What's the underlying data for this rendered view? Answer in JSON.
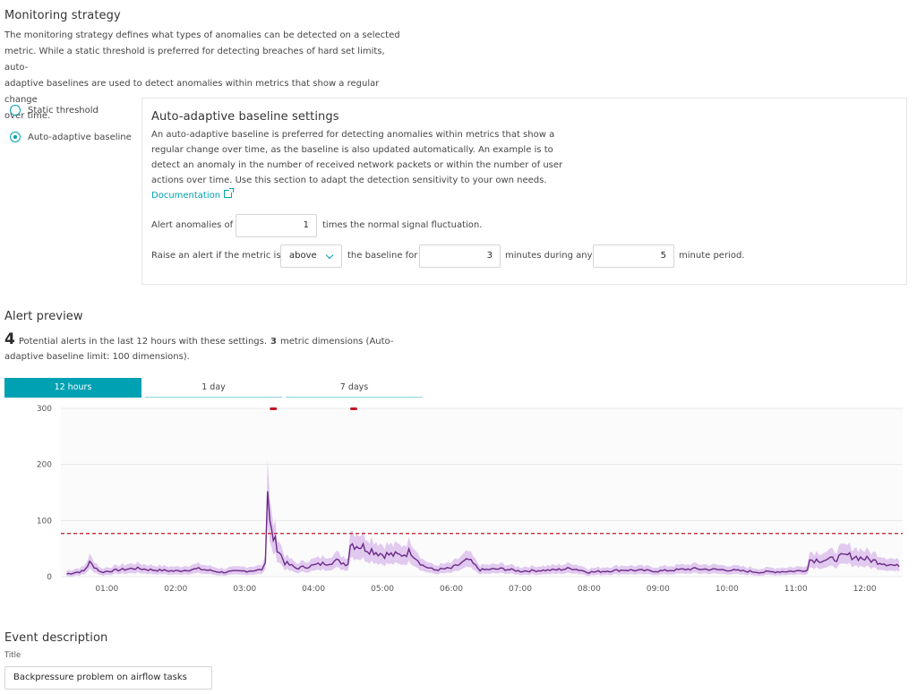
{
  "monitoring": {
    "title": "Monitoring strategy",
    "description_lines": [
      "The monitoring strategy defines what types of anomalies can be detected on a selected",
      "metric. While a static threshold is preferred for detecting breaches of hard set limits, auto-",
      "adaptive baselines are used to detect anomalies within metrics that show a regular change",
      "over time."
    ],
    "options": [
      {
        "label": "Static threshold",
        "selected": false
      },
      {
        "label": "Auto-adaptive baseline",
        "selected": true
      }
    ]
  },
  "baseline": {
    "title": "Auto-adaptive baseline settings",
    "description_lines": [
      "An auto-adaptive baseline is preferred for detecting anomalies within metrics that show a",
      "regular change over time, as the baseline is also updated automatically. An example is to",
      "detect an anomaly in the number of received network packets or within the number of user",
      "actions over time. Use this section to adapt the detection sensitivity to your own needs."
    ],
    "doc_link": "Documentation",
    "alert_prefix": "Alert anomalies of",
    "alert_value": "1",
    "alert_suffix": "times the normal signal fluctuation.",
    "raise_prefix": "Raise an alert if the metric is",
    "direction": "above",
    "baseline_for": "the baseline for",
    "minutes_value": "3",
    "minutes_during": "minutes during any",
    "period_value": "5",
    "period_suffix": "minute period."
  },
  "preview": {
    "title": "Alert preview",
    "count": "4",
    "summary_part1": "Potential alerts in the last 12 hours with these settings.",
    "dimensions": "3",
    "summary_part2": "metric dimensions (Auto-",
    "summary_line2": "adaptive baseline limit: 100 dimensions).",
    "tabs": [
      "12 hours",
      "1 day",
      "7 days"
    ],
    "active_tab": 0
  },
  "chart_data": {
    "type": "line",
    "y_ticks": [
      "300",
      "200",
      "100",
      "0"
    ],
    "ylim": [
      0,
      300
    ],
    "x_ticks": [
      "01:00",
      "02:00",
      "03:00",
      "04:00",
      "05:00",
      "06:00",
      "07:00",
      "08:00",
      "09:00",
      "10:00",
      "11:00",
      "12:00"
    ],
    "threshold": 77,
    "colors": {
      "line": "#6b2a86",
      "band": "#d6b3ea",
      "threshold": "#c41425",
      "alert": "#c41425"
    },
    "series_points": [
      [
        "00:25",
        5
      ],
      [
        "00:40",
        10
      ],
      [
        "00:45",
        25
      ],
      [
        "00:55",
        8
      ],
      [
        "01:10",
        12
      ],
      [
        "01:25",
        15
      ],
      [
        "01:40",
        12
      ],
      [
        "02:00",
        10
      ],
      [
        "02:20",
        14
      ],
      [
        "02:40",
        8
      ],
      [
        "03:00",
        10
      ],
      [
        "03:15",
        12
      ],
      [
        "03:18",
        25
      ],
      [
        "03:20",
        152
      ],
      [
        "03:22",
        100
      ],
      [
        "03:25",
        70
      ],
      [
        "03:30",
        45
      ],
      [
        "03:35",
        25
      ],
      [
        "03:45",
        15
      ],
      [
        "04:00",
        20
      ],
      [
        "04:20",
        28
      ],
      [
        "04:30",
        22
      ],
      [
        "04:32",
        60
      ],
      [
        "04:45",
        52
      ],
      [
        "05:00",
        40
      ],
      [
        "05:15",
        38
      ],
      [
        "05:25",
        45
      ],
      [
        "05:35",
        20
      ],
      [
        "05:45",
        12
      ],
      [
        "06:00",
        15
      ],
      [
        "06:15",
        30
      ],
      [
        "06:25",
        12
      ],
      [
        "06:45",
        14
      ],
      [
        "07:00",
        10
      ],
      [
        "07:30",
        12
      ],
      [
        "07:45",
        15
      ],
      [
        "08:00",
        8
      ],
      [
        "08:30",
        12
      ],
      [
        "09:00",
        10
      ],
      [
        "09:30",
        14
      ],
      [
        "10:00",
        12
      ],
      [
        "10:30",
        8
      ],
      [
        "11:00",
        10
      ],
      [
        "11:10",
        12
      ],
      [
        "11:12",
        30
      ],
      [
        "11:30",
        30
      ],
      [
        "11:45",
        38
      ],
      [
        "12:00",
        32
      ],
      [
        "12:15",
        25
      ],
      [
        "12:30",
        18
      ]
    ],
    "alert_markers": [
      "03:25",
      "04:35"
    ]
  },
  "event": {
    "title": "Event description",
    "field_label": "Title",
    "title_value": "Backpressure problem on airflow tasks"
  }
}
